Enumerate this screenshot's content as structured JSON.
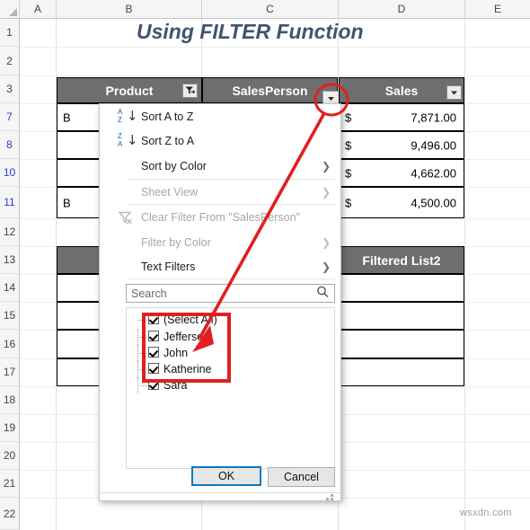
{
  "app": {
    "title": "Using FILTER Function",
    "watermark": "wsxdn.com"
  },
  "grid": {
    "column_headers": [
      "A",
      "B",
      "C",
      "D",
      "E"
    ],
    "row_headers": [
      "1",
      "2",
      "3",
      "7",
      "8",
      "10",
      "11",
      "12",
      "13",
      "14",
      "15",
      "16",
      "17",
      "18",
      "19",
      "20",
      "21",
      "22"
    ],
    "filtered_rows": [
      "7",
      "8",
      "10",
      "11"
    ]
  },
  "table_main": {
    "headers": [
      "Product",
      "SalesPerson",
      "Sales"
    ],
    "rows": [
      {
        "product": "B",
        "salesperson": "",
        "currency": "$",
        "sales": "7,871.00"
      },
      {
        "product": "",
        "salesperson": "",
        "currency": "$",
        "sales": "9,496.00"
      },
      {
        "product": "",
        "salesperson": "",
        "currency": "$",
        "sales": "4,662.00"
      },
      {
        "product": "B",
        "salesperson": "",
        "currency": "$",
        "sales": "4,500.00"
      }
    ]
  },
  "table_filtered": {
    "header_right": "Filtered List2",
    "header_left": "",
    "rows": [
      "",
      "",
      "",
      ""
    ]
  },
  "menu": {
    "items": [
      {
        "label": "Sort A to Z",
        "icon": "sort-ascending-icon",
        "disabled": false,
        "submenu": false
      },
      {
        "label": "Sort Z to A",
        "icon": "sort-descending-icon",
        "disabled": false,
        "submenu": false
      },
      {
        "label": "Sort by Color",
        "icon": "",
        "disabled": false,
        "submenu": true
      },
      {
        "label": "Sheet View",
        "icon": "",
        "disabled": true,
        "submenu": true
      },
      {
        "label": "Clear Filter From \"SalesPerson\"",
        "icon": "clear-filter-icon",
        "disabled": true,
        "submenu": false
      },
      {
        "label": "Filter by Color",
        "icon": "",
        "disabled": true,
        "submenu": true
      },
      {
        "label": "Text Filters",
        "icon": "",
        "disabled": false,
        "submenu": true
      }
    ],
    "search": {
      "placeholder": "Search",
      "value": ""
    },
    "checklist": [
      {
        "label": "(Select All)",
        "checked": true
      },
      {
        "label": "Jefferson",
        "checked": true
      },
      {
        "label": "John",
        "checked": true
      },
      {
        "label": "Katherine",
        "checked": true
      },
      {
        "label": "Sara",
        "checked": true
      }
    ],
    "ok_label": "OK",
    "cancel_label": "Cancel"
  },
  "annotation": {
    "highlight_color": "#e02020",
    "target": "salesperson-filter-button",
    "callout_items": [
      "Jefferson",
      "John",
      "Katherine",
      "Sara"
    ]
  }
}
